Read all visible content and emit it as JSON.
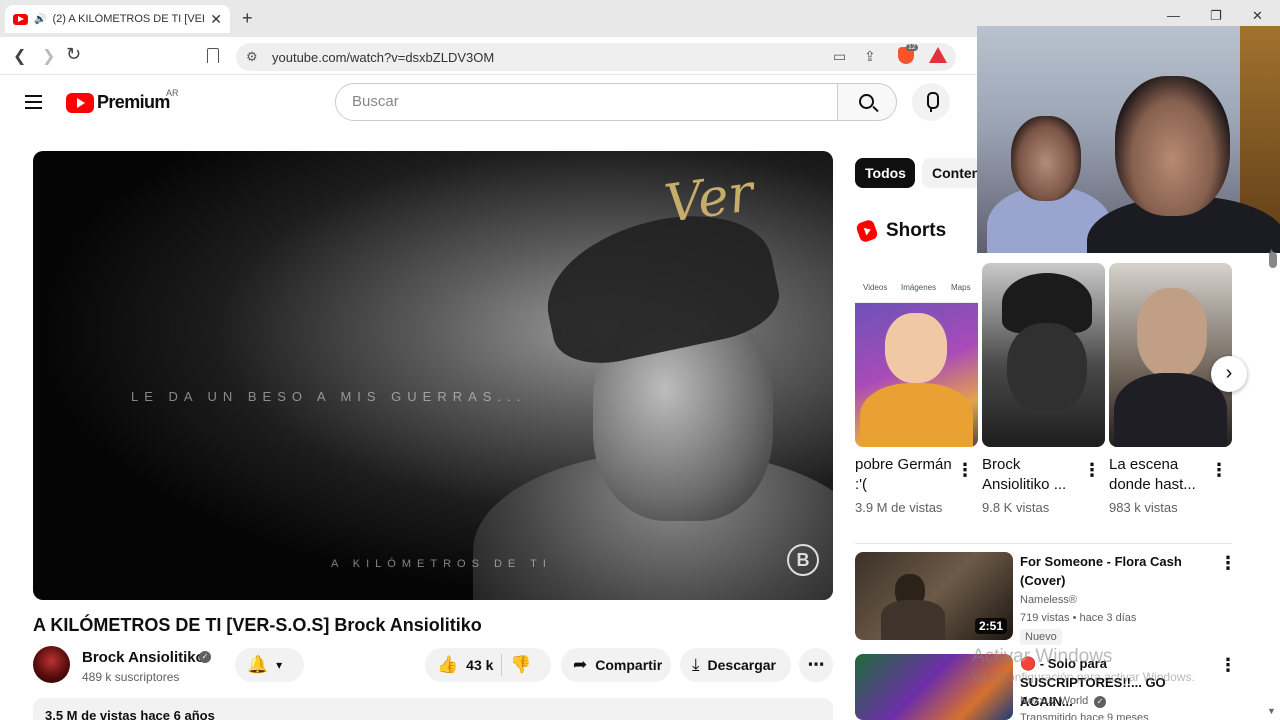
{
  "browser": {
    "tab_title": "(2) A KILÓMETROS DE TI [VER",
    "url": "youtube.com/watch?v=dsxbZLDV3OM",
    "extension_badge": "12"
  },
  "header": {
    "logo_text": "Premium",
    "region": "AR",
    "search_placeholder": "Buscar"
  },
  "player": {
    "overlay_line_1": "LE DA UN BESO A MIS GUERRAS...",
    "overlay_line_2": "A KILÓMETROS DE TI",
    "logo_script": "Ver",
    "watermark_letter": "B"
  },
  "video": {
    "title": "A KILÓMETROS DE TI [VER-S.O.S] Brock Ansiolitiko",
    "channel": "Brock Ansiolitiko",
    "subscribers": "489 k suscriptores",
    "likes": "43 k",
    "share_label": "Compartir",
    "download_label": "Descargar",
    "description_preview": "3,5 M de vistas  hace 6 años"
  },
  "sidebar": {
    "chips": [
      "Todos",
      "Contenido"
    ],
    "shorts_label": "Shorts",
    "shorts": [
      {
        "title": "pobre Germán :'(",
        "views": "3.9 M de vistas"
      },
      {
        "title": "Brock Ansiolitiko ...",
        "views": "9.8 K vistas"
      },
      {
        "title": "La escena donde hast...",
        "views": "983 k vistas"
      }
    ],
    "shorts_thumb_tabs": [
      "Videos",
      "Imágenes",
      "Maps"
    ],
    "recommended": [
      {
        "title": "For Someone - Flora Cash (Cover)",
        "channel": "Nameless®",
        "meta": "719 vistas • hace 3 días",
        "badge": "Nuevo",
        "duration": "2:51"
      },
      {
        "title": "🔴 - Solo para SUSCRIPTORES!!... GO AGAIN...",
        "channel": "Nexxuz World",
        "meta": "Transmitido hace 9 meses"
      }
    ]
  },
  "overlay": {
    "windows_watermark_1": "Activar Windows",
    "windows_watermark_2": "Ve a Configuración para activar Windows."
  },
  "colors": {
    "youtube_red": "#ff0000",
    "brave_orange": "#fb542b",
    "chip_active_bg": "#0f0f0f"
  }
}
